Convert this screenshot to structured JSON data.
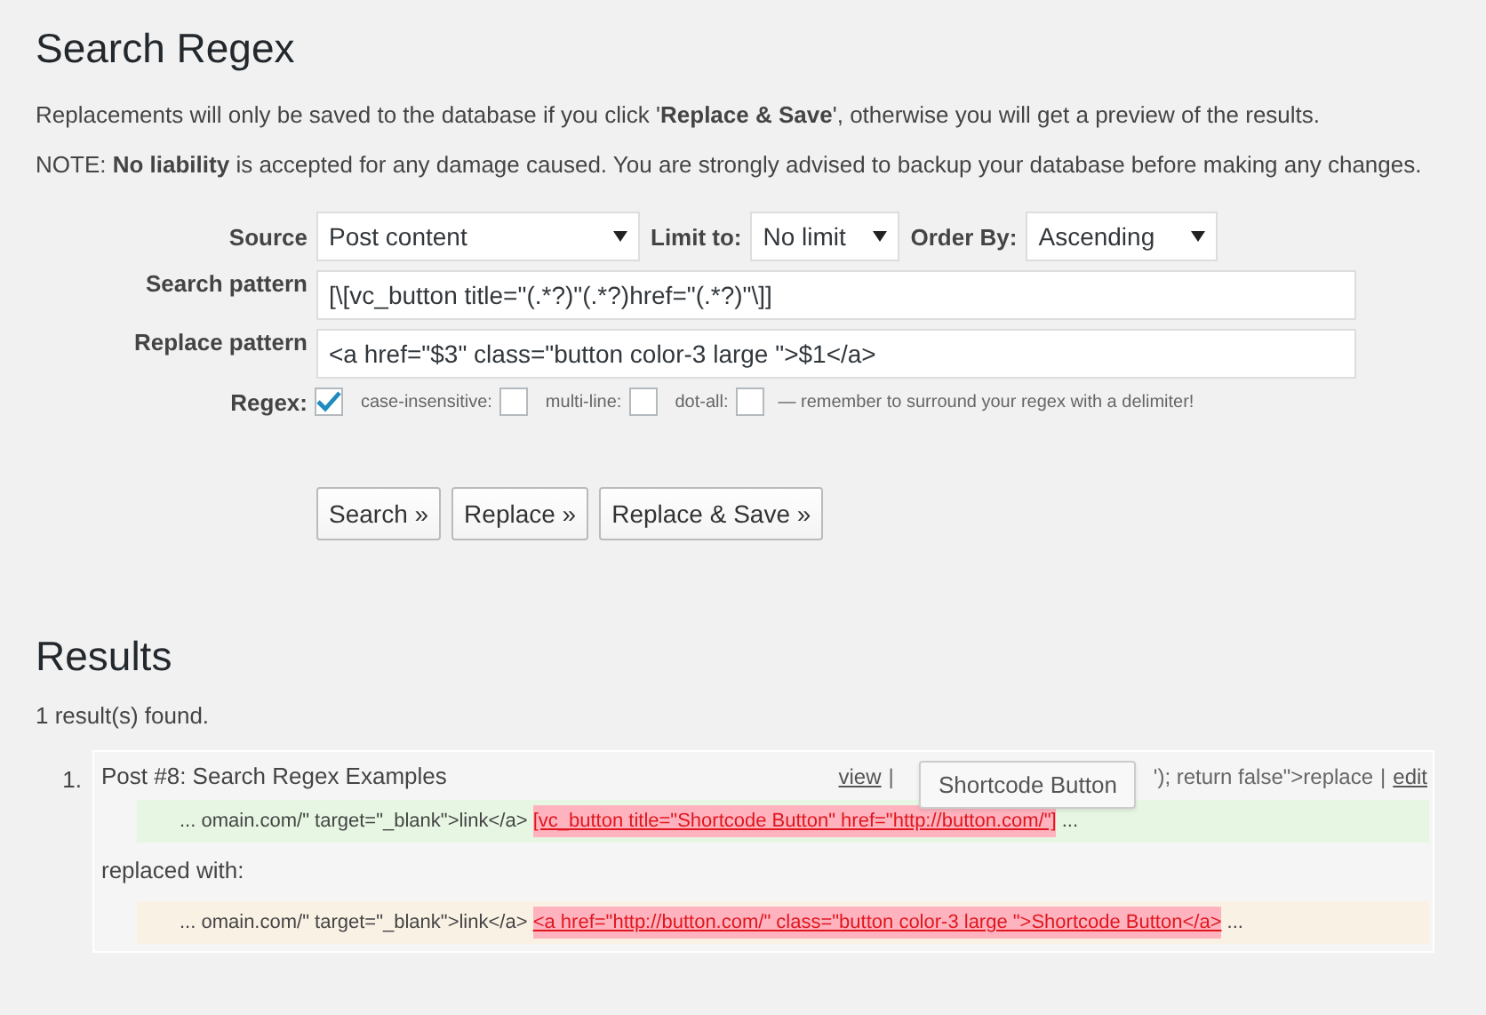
{
  "title": "Search Regex",
  "notes": [
    "Replacements will only be saved to the database if you click '**Replace & Save**', otherwise you will get a preview of the results.",
    "NOTE: **No liability** is accepted for any damage caused. You are strongly advised to backup your database before making any changes."
  ],
  "form": {
    "selects": [
      {
        "label": "Source",
        "value": "Post content"
      },
      {
        "label": "Limit to:",
        "value": "No limit"
      },
      {
        "label": "Order By:",
        "value": "Ascending"
      }
    ],
    "fields": [
      {
        "label": "Search pattern",
        "value": "[\\[vc_button title=\"(.*?)\"(.*?)href=\"(.*?)\"\\]]"
      },
      {
        "label": "Replace pattern",
        "value": "<a href=\"$3\" class=\"button color-3 large \">$1</a>"
      }
    ],
    "regex": {
      "label": "Regex:",
      "checked": true,
      "options": [
        {
          "label": "case-insensitive:",
          "checked": false
        },
        {
          "label": "multi-line:",
          "checked": false
        },
        {
          "label": "dot-all:",
          "checked": false
        }
      ],
      "hint": "— remember to surround your regex with a delimiter!"
    },
    "buttons": [
      "Search »",
      "Replace »",
      "Replace & Save »"
    ]
  },
  "results": {
    "heading": "Results",
    "count": "1 result(s) found.",
    "items": [
      {
        "number": "1.",
        "title": "Post #8: Search Regex Examples",
        "actions": [
          {
            "kind": "link",
            "text": "view"
          },
          {
            "kind": "sep",
            "text": "|"
          },
          {
            "kind": "text",
            "text": "'); return false\">replace"
          },
          {
            "kind": "sep",
            "text": "|"
          },
          {
            "kind": "link",
            "text": "edit"
          }
        ],
        "tooltip": "Shortcode Button",
        "found": {
          "before": "... omain.com/\" target=\"_blank\">link</a>",
          "match": "[vc_button title=\"Shortcode Button\" href=\"http://button.com/\"]",
          "after": "..."
        },
        "replaced_label": "replaced with:",
        "replaced": {
          "before": "... omain.com/\" target=\"_blank\">link</a>",
          "match": "<a href=\"http://button.com/\" class=\"button color-3 large \">Shortcode Button</a>",
          "after": "..."
        }
      }
    ]
  }
}
